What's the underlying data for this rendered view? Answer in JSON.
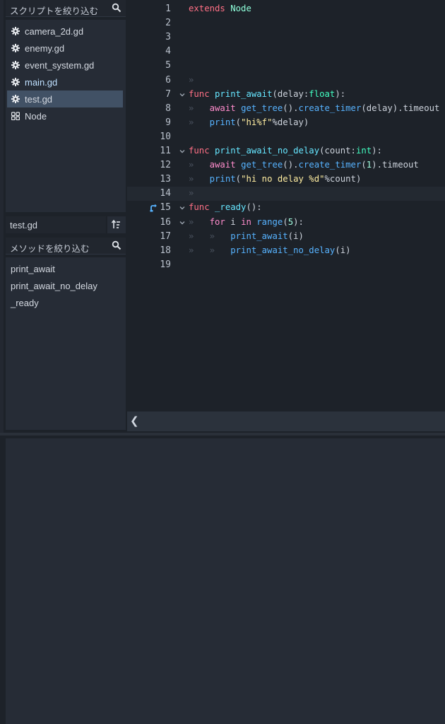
{
  "script_panel": {
    "filter_placeholder": "スクリプトを絞り込む",
    "items": [
      {
        "label": "camera_2d.gd",
        "icon": "gear-icon"
      },
      {
        "label": "enemy.gd",
        "icon": "gear-icon"
      },
      {
        "label": "event_system.gd",
        "icon": "gear-icon"
      },
      {
        "label": "main.gd",
        "icon": "gear-icon"
      },
      {
        "label": "test.gd",
        "icon": "gear-icon",
        "selected": true
      },
      {
        "label": "Node",
        "icon": "node-icon"
      }
    ],
    "current_file": "test.gd",
    "method_filter_placeholder": "メソッドを絞り込む",
    "methods": [
      "print_await",
      "print_await_no_delay",
      "_ready"
    ]
  },
  "editor": {
    "line_numbers": [
      "1",
      "2",
      "3",
      "4",
      "5",
      "6",
      "7",
      "8",
      "9",
      "10",
      "11",
      "12",
      "13",
      "14",
      "15",
      "16",
      "17",
      "18",
      "19"
    ],
    "current_line": "14",
    "code": [
      [
        {
          "t": "extends",
          "c": "kw"
        },
        {
          "t": " "
        },
        {
          "t": "Node",
          "c": "cls"
        }
      ],
      [],
      [],
      [],
      [],
      [
        {
          "t": "»",
          "c": "tab"
        }
      ],
      [
        {
          "t": "func",
          "c": "kw"
        },
        {
          "t": " "
        },
        {
          "t": "print_await",
          "c": "fnd"
        },
        {
          "t": "(delay:"
        },
        {
          "t": "float",
          "c": "ty"
        },
        {
          "t": "):"
        }
      ],
      [
        {
          "t": "»   ",
          "c": "tab"
        },
        {
          "t": "await",
          "c": "ctl"
        },
        {
          "t": " "
        },
        {
          "t": "get_tree",
          "c": "fn"
        },
        {
          "t": "()."
        },
        {
          "t": "create_timer",
          "c": "fn"
        },
        {
          "t": "(delay).timeout"
        }
      ],
      [
        {
          "t": "»   ",
          "c": "tab"
        },
        {
          "t": "print",
          "c": "fn"
        },
        {
          "t": "("
        },
        {
          "t": "\"hi%f\"",
          "c": "str"
        },
        {
          "t": "%delay)"
        }
      ],
      [],
      [
        {
          "t": "func",
          "c": "kw"
        },
        {
          "t": " "
        },
        {
          "t": "print_await_no_delay",
          "c": "fnd"
        },
        {
          "t": "(count:"
        },
        {
          "t": "int",
          "c": "ty"
        },
        {
          "t": "):"
        }
      ],
      [
        {
          "t": "»   ",
          "c": "tab"
        },
        {
          "t": "await",
          "c": "ctl"
        },
        {
          "t": " "
        },
        {
          "t": "get_tree",
          "c": "fn"
        },
        {
          "t": "()."
        },
        {
          "t": "create_timer",
          "c": "fn"
        },
        {
          "t": "("
        },
        {
          "t": "1",
          "c": "num"
        },
        {
          "t": ").timeout"
        }
      ],
      [
        {
          "t": "»   ",
          "c": "tab"
        },
        {
          "t": "print",
          "c": "fn"
        },
        {
          "t": "("
        },
        {
          "t": "\"hi no delay %d\"",
          "c": "str"
        },
        {
          "t": "%count)"
        }
      ],
      [
        {
          "t": "»",
          "c": "tab"
        }
      ],
      [
        {
          "t": "func",
          "c": "kw"
        },
        {
          "t": " "
        },
        {
          "t": "_ready",
          "c": "fnd"
        },
        {
          "t": "():"
        }
      ],
      [
        {
          "t": "»   ",
          "c": "tab"
        },
        {
          "t": "for",
          "c": "ctl"
        },
        {
          "t": " i "
        },
        {
          "t": "in",
          "c": "ctl"
        },
        {
          "t": " "
        },
        {
          "t": "range",
          "c": "fn"
        },
        {
          "t": "("
        },
        {
          "t": "5",
          "c": "num"
        },
        {
          "t": "):"
        }
      ],
      [
        {
          "t": "»   »   ",
          "c": "tab"
        },
        {
          "t": "print_await",
          "c": "fn"
        },
        {
          "t": "(i)"
        }
      ],
      [
        {
          "t": "»   »   ",
          "c": "tab"
        },
        {
          "t": "print_await_no_delay",
          "c": "fn"
        },
        {
          "t": "(i)"
        }
      ],
      []
    ],
    "fold_lines": [
      "7",
      "11",
      "15",
      "16"
    ],
    "override_marker_line": "15",
    "collapse_glyph": "❮"
  },
  "colors": {
    "background": "#1d2229",
    "panel": "#262c36",
    "selected": "#415165",
    "keyword": "#ff7085",
    "control_flow": "#ff8ccc",
    "function": "#57b3ff",
    "string": "#ffeda1",
    "number": "#a1ffe0",
    "type": "#42ffc2"
  }
}
